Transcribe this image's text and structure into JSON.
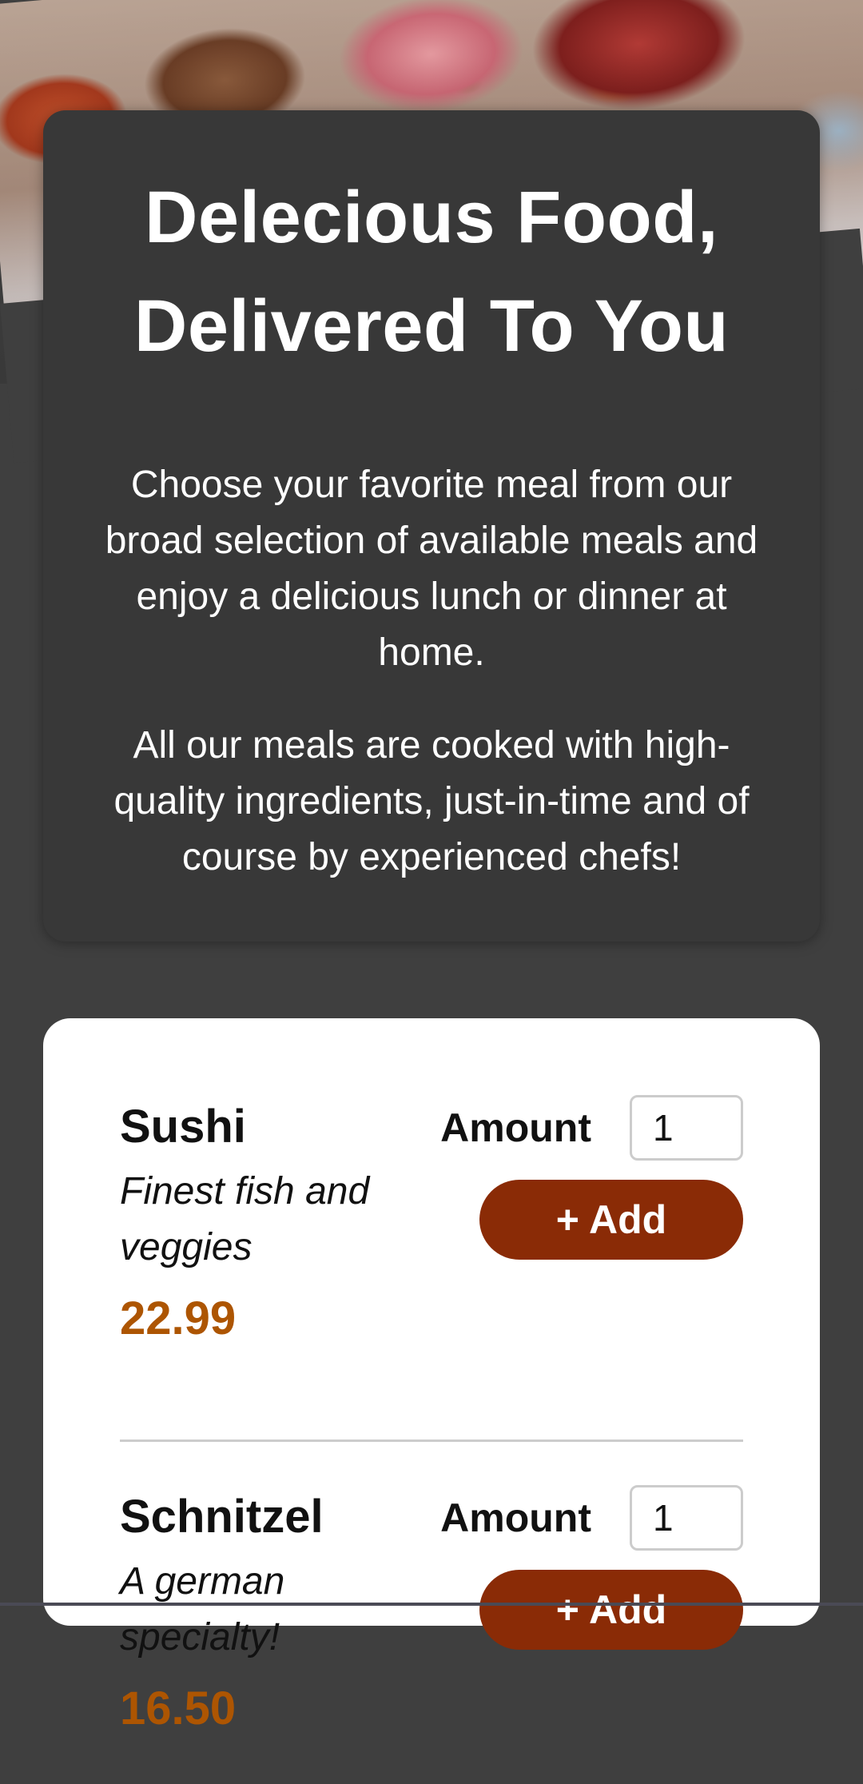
{
  "summary": {
    "title_line1": "Delecious Food,",
    "title_line2": "Delivered To You",
    "paragraph1": "Choose your favorite meal from our broad selection of available meals and enjoy a delicious lunch or dinner at home.",
    "paragraph2": "All our meals are cooked with high-quality ingredients, just-in-time and of course by experienced chefs!"
  },
  "meals": [
    {
      "name": "Sushi",
      "description": "Finest fish and veggies",
      "price": "22.99",
      "amount_label": "Amount",
      "amount_value": "1",
      "add_label": "+ Add"
    },
    {
      "name": "Schnitzel",
      "description": "A german specialty!",
      "price": "16.50",
      "amount_label": "Amount",
      "amount_value": "1",
      "add_label": "+ Add"
    }
  ],
  "colors": {
    "background": "#3f3f3f",
    "summary_card": "#383838",
    "accent_button": "#8a2b06",
    "price": "#ad5502"
  }
}
